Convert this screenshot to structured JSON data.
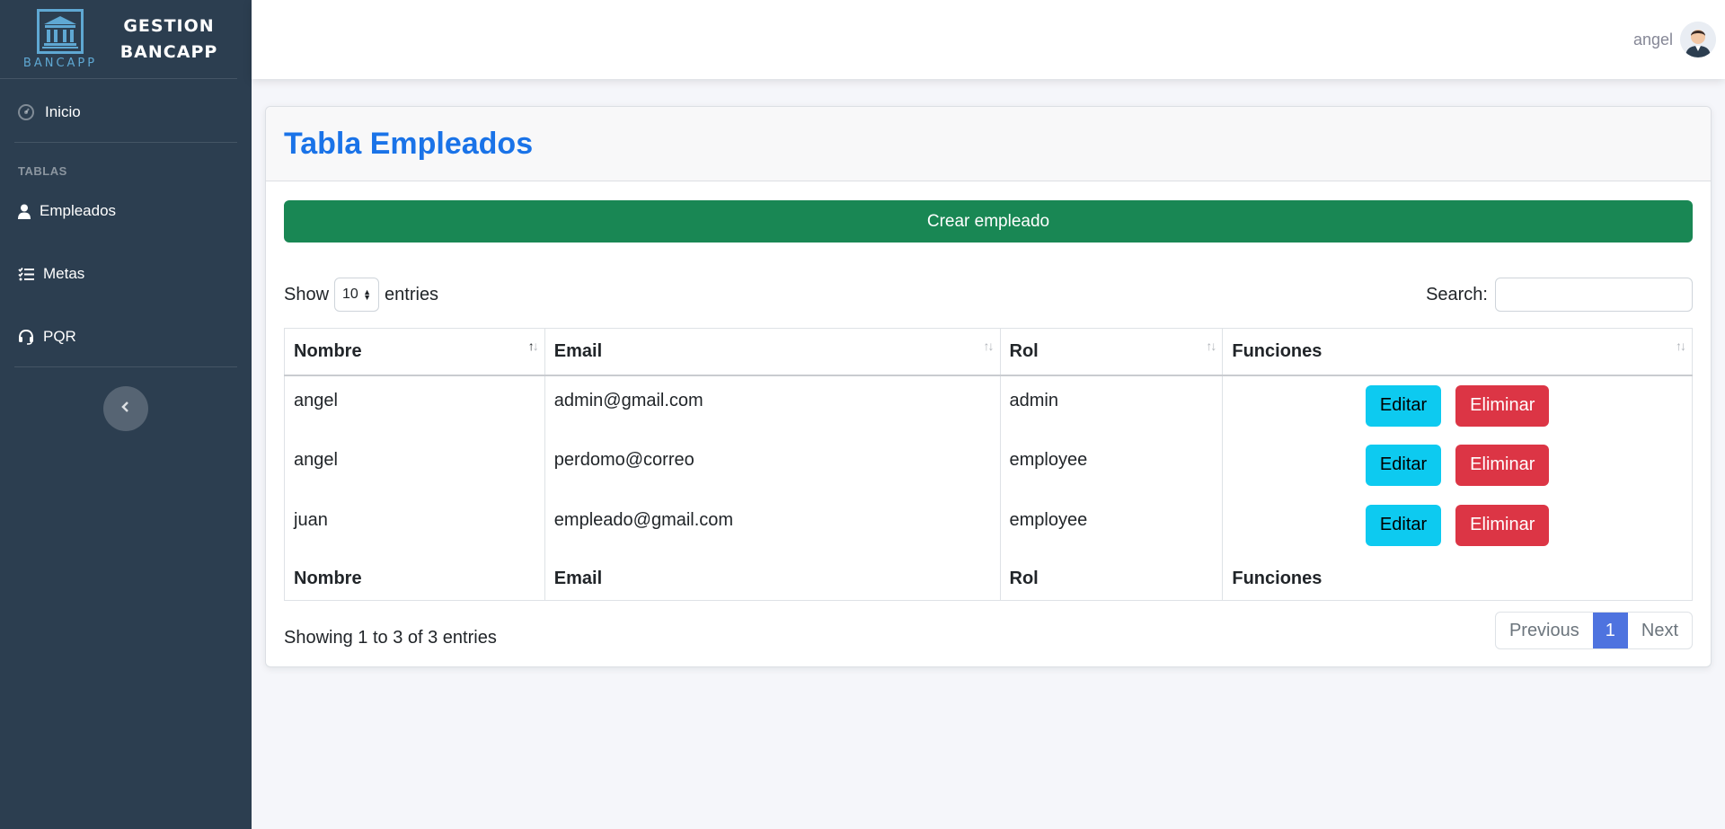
{
  "brand": {
    "logo_text": "BANCAPP",
    "name_line1": "GESTION",
    "name_line2": "BANCAPP"
  },
  "sidebar": {
    "items": [
      {
        "label": "Inicio",
        "icon": "dashboard-icon"
      },
      {
        "label": "Empleados",
        "icon": "user-icon"
      },
      {
        "label": "Metas",
        "icon": "tasks-list-icon"
      },
      {
        "label": "PQR",
        "icon": "headset-icon"
      }
    ],
    "heading": "TABLAS",
    "collapse_icon": "chevron-left-icon"
  },
  "topbar": {
    "user_name": "angel",
    "avatar_icon": "user-avatar"
  },
  "card": {
    "title": "Tabla Empleados",
    "create_button": "Crear empleado"
  },
  "table_controls": {
    "show_label": "Show",
    "entries_value": "10",
    "entries_label": "entries",
    "search_label": "Search:",
    "search_value": ""
  },
  "table": {
    "columns": [
      "Nombre",
      "Email",
      "Rol",
      "Funciones"
    ],
    "rows": [
      {
        "nombre": "angel",
        "email": "admin@gmail.com",
        "rol": "admin"
      },
      {
        "nombre": "angel",
        "email": "perdomo@correo",
        "rol": "employee"
      },
      {
        "nombre": "juan",
        "email": "empleado@gmail.com",
        "rol": "employee"
      }
    ],
    "edit_label": "Editar",
    "delete_label": "Eliminar"
  },
  "footer": {
    "info": "Showing 1 to 3 of 3 entries",
    "previous": "Previous",
    "page": "1",
    "next": "Next"
  },
  "colors": {
    "sidebar_bg": "#2c3e50",
    "title": "#1a73e8",
    "create_button": "#198754",
    "edit_button": "#0dcaf0",
    "delete_button": "#dc3545",
    "active_page": "#4e73df"
  }
}
